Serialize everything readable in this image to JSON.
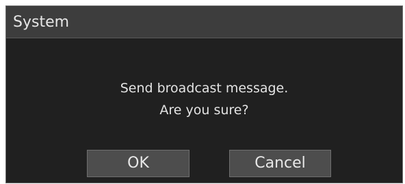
{
  "dialog": {
    "title": "System",
    "message_line1": "Send broadcast message.",
    "message_line2": "Are you sure?",
    "ok_label": "OK",
    "cancel_label": "Cancel"
  },
  "colors": {
    "background": "#202020",
    "titlebar": "#3d3d3d",
    "button": "#4d4d4d",
    "text": "#e6e6e6"
  }
}
